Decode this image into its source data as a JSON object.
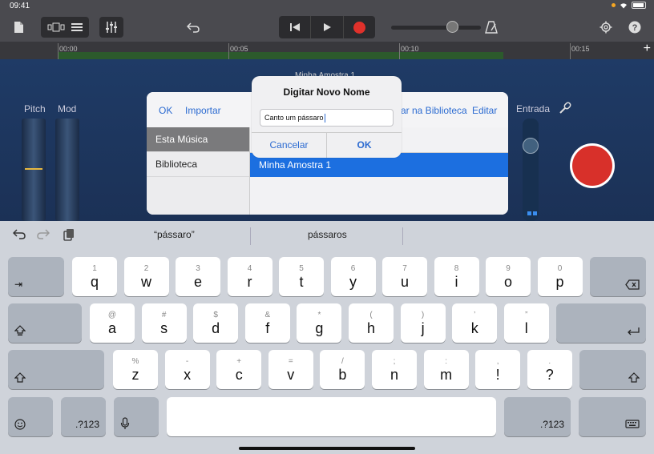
{
  "status": {
    "time": "09:41"
  },
  "ruler": {
    "labels": [
      "00:00",
      "00:05",
      "00:10",
      "00:15"
    ],
    "plus": "+"
  },
  "instrument": {
    "pitch": "Pitch",
    "mod": "Mod",
    "input": "Entrada"
  },
  "track_name": "Minha Amostra 1",
  "sheet": {
    "ok": "OK",
    "import": "Importar",
    "library_fragment": "ar na Biblioteca",
    "edit": "Editar",
    "sidebar": [
      "Esta Música",
      "Biblioteca"
    ],
    "rows": [
      "Minha Amostra 1"
    ]
  },
  "alert": {
    "title": "Digitar Novo Nome",
    "value": "Canto um pássaro",
    "cancel": "Cancelar",
    "ok": "OK"
  },
  "keyboard": {
    "suggestions": [
      "“pássaro”",
      "pássaros"
    ],
    "row1": [
      {
        "k": "q",
        "n": "1"
      },
      {
        "k": "w",
        "n": "2"
      },
      {
        "k": "e",
        "n": "3"
      },
      {
        "k": "r",
        "n": "4"
      },
      {
        "k": "t",
        "n": "5"
      },
      {
        "k": "y",
        "n": "6"
      },
      {
        "k": "u",
        "n": "7"
      },
      {
        "k": "i",
        "n": "8"
      },
      {
        "k": "o",
        "n": "9"
      },
      {
        "k": "p",
        "n": "0"
      }
    ],
    "row2": [
      {
        "k": "a",
        "n": "@"
      },
      {
        "k": "s",
        "n": "#"
      },
      {
        "k": "d",
        "n": "$"
      },
      {
        "k": "f",
        "n": "&"
      },
      {
        "k": "g",
        "n": "*"
      },
      {
        "k": "h",
        "n": "("
      },
      {
        "k": "j",
        "n": ")"
      },
      {
        "k": "k",
        "n": "’"
      },
      {
        "k": "l",
        "n": "”"
      }
    ],
    "row3": [
      {
        "k": "z",
        "n": "%"
      },
      {
        "k": "x",
        "n": "-"
      },
      {
        "k": "c",
        "n": "+"
      },
      {
        "k": "v",
        "n": "="
      },
      {
        "k": "b",
        "n": "/"
      },
      {
        "k": "n",
        "n": ";"
      },
      {
        "k": "m",
        "n": ":"
      },
      {
        "k": "!",
        "n": ","
      },
      {
        "k": "?",
        "n": "."
      }
    ],
    "numbers_label": ".?123"
  },
  "colors": {
    "accent": "#2c6bd1",
    "record": "#e0312b",
    "selection": "#1c6fe0"
  }
}
